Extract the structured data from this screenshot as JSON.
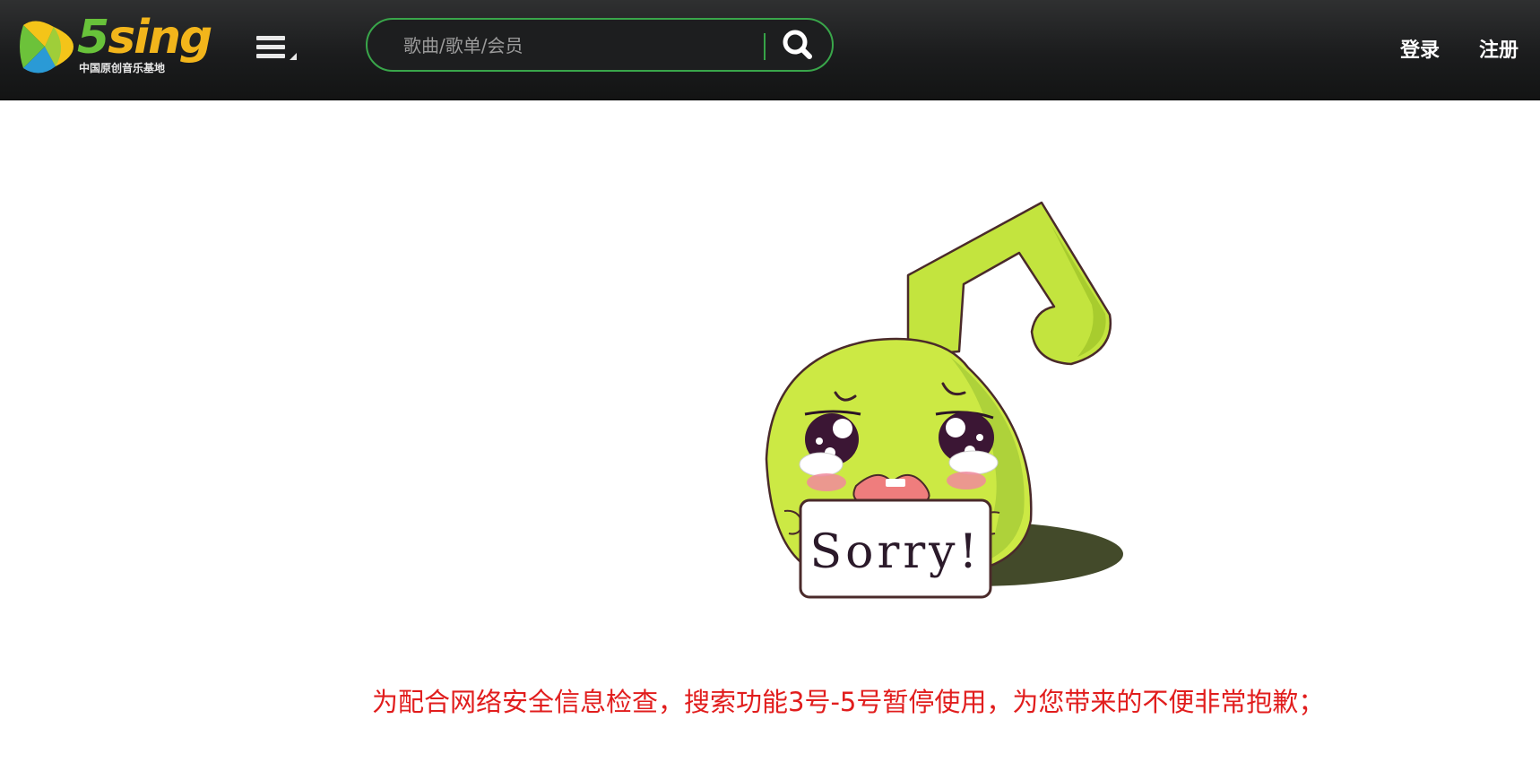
{
  "header": {
    "logo": {
      "brand_number": "5",
      "brand_word": "sing",
      "tagline": "中国原创音乐基地"
    },
    "menu_icon": "hamburger-icon",
    "search": {
      "placeholder": "歌曲/歌单/会员",
      "value": "",
      "icon": "search-icon"
    },
    "login_label": "登录",
    "register_label": "注册"
  },
  "main": {
    "illustration": {
      "sign_text": "Sorry!"
    },
    "notice": "为配合网络安全信息检查，搜索功能3号-5号暂停使用，为您带来的不便非常抱歉；"
  },
  "colors": {
    "header_bg": "#1b1c1d",
    "search_border": "#39a64a",
    "notice_text": "#e11d1d",
    "mascot_body": "#c8ec40"
  }
}
